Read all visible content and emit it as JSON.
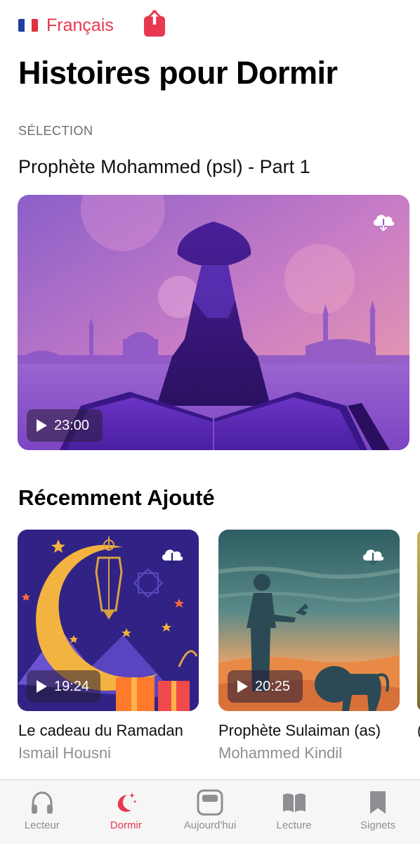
{
  "header": {
    "language_label": "Français",
    "language_flag_icon": "france-flag-icon",
    "share_icon": "share-icon",
    "title": "Histoires pour Dormir",
    "accent_color": "#e8384f"
  },
  "featured": {
    "caption": "SÉLECTION",
    "title": "Prophète Mohammed (psl) - Part 1",
    "duration": "23:00",
    "download_icon": "cloud-download-icon"
  },
  "recent": {
    "title": "Récemment Ajouté",
    "items": [
      {
        "title": "Le cadeau du Ramadan",
        "author": "Ismail Housni",
        "duration": "19:24"
      },
      {
        "title": "Prophète Sulaiman (as)",
        "author": "Mohammed Kindil",
        "duration": "20:25"
      }
    ],
    "peek_title_fragment": "("
  },
  "tabbar": {
    "tabs": [
      {
        "label": "Lecteur",
        "icon": "headphones-icon",
        "active": false
      },
      {
        "label": "Dormir",
        "icon": "moon-stars-icon",
        "active": true
      },
      {
        "label": "Aujourd'hui",
        "icon": "today-widget-icon",
        "active": false
      },
      {
        "label": "Lecture",
        "icon": "book-icon",
        "active": false
      },
      {
        "label": "Signets",
        "icon": "bookmark-icon",
        "active": false
      }
    ]
  }
}
